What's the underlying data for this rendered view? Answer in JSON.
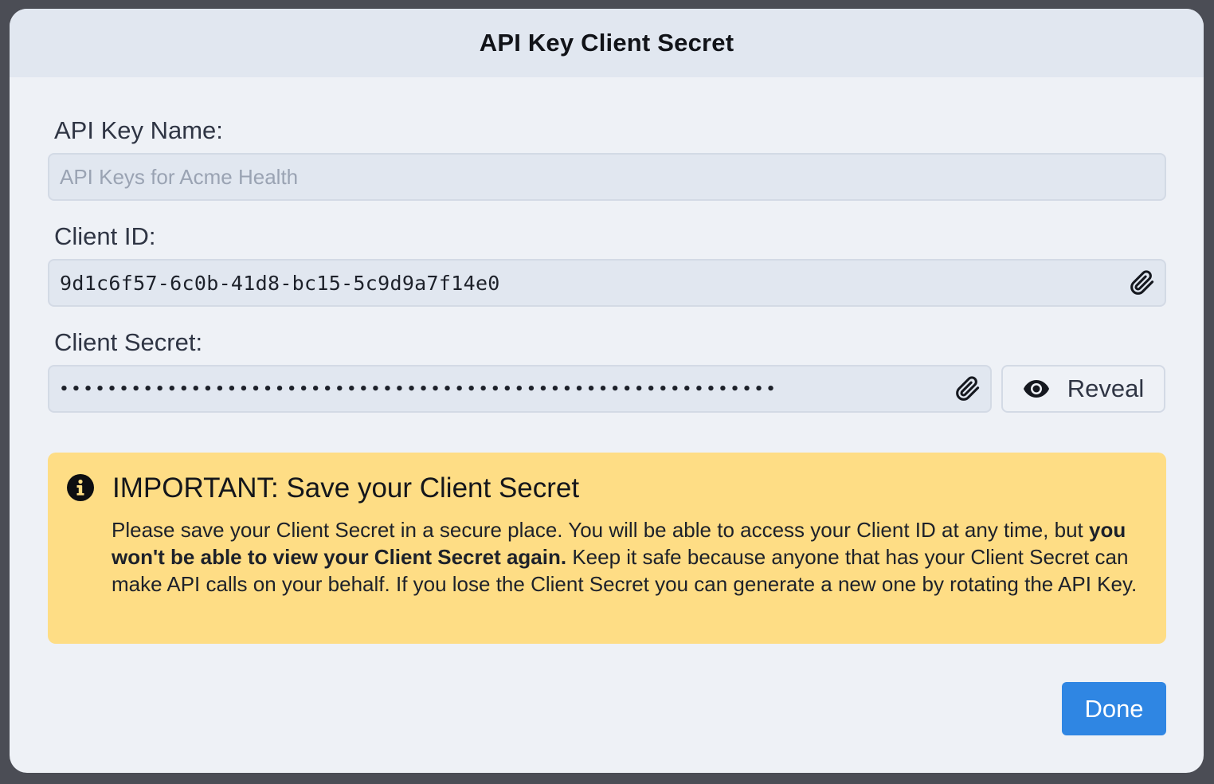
{
  "dialog": {
    "title": "API Key Client Secret"
  },
  "fields": {
    "api_key_name": {
      "label": "API Key Name:",
      "placeholder": "API Keys for Acme Health",
      "value": ""
    },
    "client_id": {
      "label": "Client ID:",
      "value": "9d1c6f57-6c0b-41d8-bc15-5c9d9a7f14e0",
      "copy_icon": "paperclip-icon"
    },
    "client_secret": {
      "label": "Client Secret:",
      "masked_value": "••••••••••••••••••••••••••••••••••••••••••••••••••••••••••••",
      "copy_icon": "paperclip-icon",
      "reveal_label": "Reveal",
      "reveal_icon": "eye-icon"
    }
  },
  "alert": {
    "icon": "info-circle-icon",
    "title": "IMPORTANT: Save your Client Secret",
    "body_part1": "Please save your Client Secret in a secure place. You will be able to access your Client ID at any time, but ",
    "body_bold": "you won't be able to view your Client Secret again.",
    "body_part2": " Keep it safe because anyone that has your Client Secret can make API calls on your behalf. If you lose the Client Secret you can generate a new one by rotating the API Key.",
    "background_color": "#fedd85"
  },
  "footer": {
    "done_label": "Done",
    "accent_color": "#2f86e3"
  }
}
